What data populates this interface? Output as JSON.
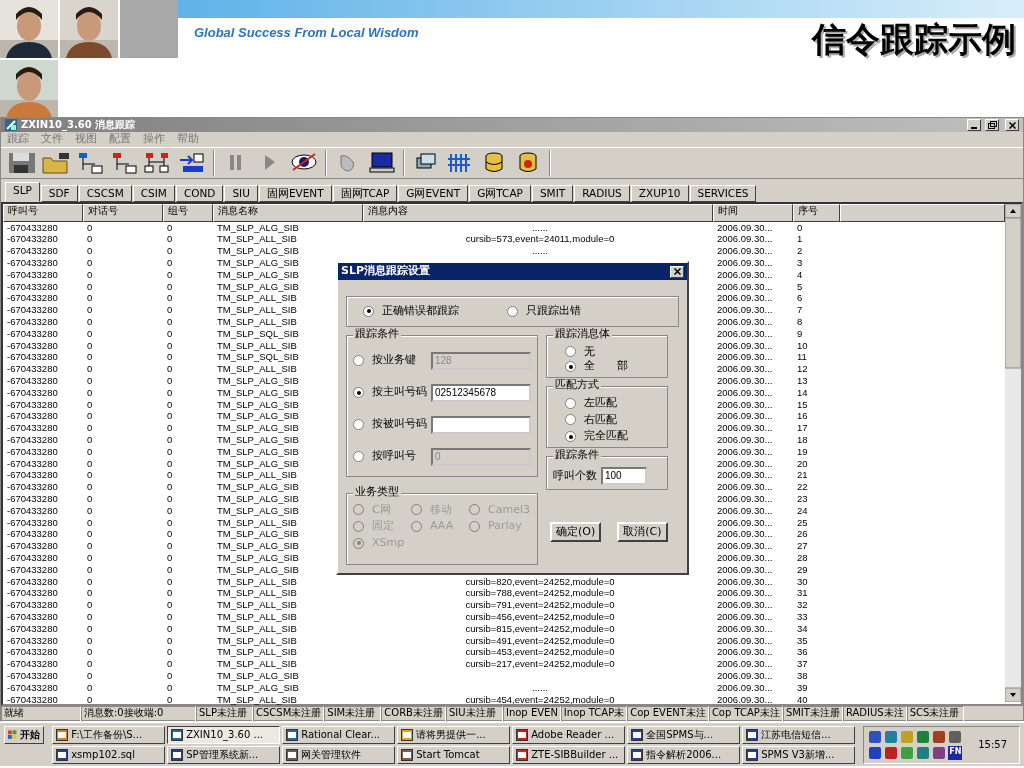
{
  "slide_header": {
    "slogan": "Global Success From Local Wisdom",
    "title": "信令跟踪示例"
  },
  "window": {
    "title": "ZXIN10_3.60 消息跟踪"
  },
  "menu": [
    "跟踪",
    "文件",
    "视图",
    "配置",
    "操作",
    "帮助"
  ],
  "tabs": [
    {
      "label": "SLP",
      "selected": true
    },
    {
      "label": "SDF",
      "selected": false
    },
    {
      "label": "CSCSM",
      "selected": false
    },
    {
      "label": "CSIM",
      "selected": false
    },
    {
      "label": "COND",
      "selected": false
    },
    {
      "label": "SIU",
      "selected": false
    },
    {
      "label": "固网EVENT",
      "selected": false
    },
    {
      "label": "固网TCAP",
      "selected": false
    },
    {
      "label": "G网EVENT",
      "selected": false
    },
    {
      "label": "G网TCAP",
      "selected": false
    },
    {
      "label": "SMIT",
      "selected": false
    },
    {
      "label": "RADIUS",
      "selected": false
    },
    {
      "label": "ZXUP10",
      "selected": false
    },
    {
      "label": "SERVICES",
      "selected": false
    }
  ],
  "table": {
    "columns": [
      "呼叫号",
      "对话号",
      "组号",
      "消息名称",
      "消息内容",
      "时间",
      "序号"
    ],
    "rows": [
      {
        "call": "-670433280",
        "dialog": "0",
        "group": "0",
        "name": "TM_SLP_ALG_SIB",
        "content": "......",
        "time": "2006.09.30...",
        "seq": "0"
      },
      {
        "call": "-670433280",
        "dialog": "0",
        "group": "0",
        "name": "TM_SLP_ALL_SIB",
        "content": "cursib=573,event=24011,module=0",
        "time": "2006.09.30...",
        "seq": "1"
      },
      {
        "call": "-670433280",
        "dialog": "0",
        "group": "0",
        "name": "TM_SLP_ALG_SIB",
        "content": "......",
        "time": "2006.09.30...",
        "seq": "2"
      },
      {
        "call": "-670433280",
        "dialog": "0",
        "group": "0",
        "name": "TM_SLP_ALG_SIB",
        "time": "2006.09.30...",
        "seq": "3"
      },
      {
        "call": "-670433280",
        "dialog": "0",
        "group": "0",
        "name": "TM_SLP_ALG_SIB",
        "time": "2006.09.30...",
        "seq": "4"
      },
      {
        "call": "-670433280",
        "dialog": "0",
        "group": "0",
        "name": "TM_SLP_ALG_SIB",
        "time": "2006.09.30...",
        "seq": "5"
      },
      {
        "call": "-670433280",
        "dialog": "0",
        "group": "0",
        "name": "TM_SLP_ALL_SIB",
        "time": "2006.09.30...",
        "seq": "6"
      },
      {
        "call": "-670433280",
        "dialog": "0",
        "group": "0",
        "name": "TM_SLP_ALL_SIB",
        "time": "2006.09.30...",
        "seq": "7"
      },
      {
        "call": "-670433280",
        "dialog": "0",
        "group": "0",
        "name": "TM_SLP_ALL_SIB",
        "time": "2006.09.30...",
        "seq": "8"
      },
      {
        "call": "-670433280",
        "dialog": "0",
        "group": "0",
        "name": "TM_SLP_SQL_SIB",
        "time": "2006.09.30...",
        "seq": "9"
      },
      {
        "call": "-670433280",
        "dialog": "0",
        "group": "0",
        "name": "TM_SLP_ALL_SIB",
        "time": "2006.09.30...",
        "seq": "10"
      },
      {
        "call": "-670433280",
        "dialog": "0",
        "group": "0",
        "name": "TM_SLP_SQL_SIB",
        "time": "2006.09.30...",
        "seq": "11"
      },
      {
        "call": "-670433280",
        "dialog": "0",
        "group": "0",
        "name": "TM_SLP_ALL_SIB",
        "time": "2006.09.30...",
        "seq": "12"
      },
      {
        "call": "-670433280",
        "dialog": "0",
        "group": "0",
        "name": "TM_SLP_ALG_SIB",
        "time": "2006.09.30...",
        "seq": "13"
      },
      {
        "call": "-670433280",
        "dialog": "0",
        "group": "0",
        "name": "TM_SLP_ALG_SIB",
        "time": "2006.09.30...",
        "seq": "14"
      },
      {
        "call": "-670433280",
        "dialog": "0",
        "group": "0",
        "name": "TM_SLP_ALG_SIB",
        "time": "2006.09.30...",
        "seq": "15"
      },
      {
        "call": "-670433280",
        "dialog": "0",
        "group": "0",
        "name": "TM_SLP_ALG_SIB",
        "time": "2006.09.30...",
        "seq": "16"
      },
      {
        "call": "-670433280",
        "dialog": "0",
        "group": "0",
        "name": "TM_SLP_ALG_SIB",
        "time": "2006.09.30...",
        "seq": "17"
      },
      {
        "call": "-670433280",
        "dialog": "0",
        "group": "0",
        "name": "TM_SLP_ALG_SIB",
        "time": "2006.09.30...",
        "seq": "18"
      },
      {
        "call": "-670433280",
        "dialog": "0",
        "group": "0",
        "name": "TM_SLP_ALG_SIB",
        "time": "2006.09.30...",
        "seq": "19"
      },
      {
        "call": "-670433280",
        "dialog": "0",
        "group": "0",
        "name": "TM_SLP_ALG_SIB",
        "time": "2006.09.30...",
        "seq": "20"
      },
      {
        "call": "-670433280",
        "dialog": "0",
        "group": "0",
        "name": "TM_SLP_ALL_SIB",
        "time": "2006.09.30...",
        "seq": "21"
      },
      {
        "call": "-670433280",
        "dialog": "0",
        "group": "0",
        "name": "TM_SLP_ALG_SIB",
        "time": "2006.09.30...",
        "seq": "22"
      },
      {
        "call": "-670433280",
        "dialog": "0",
        "group": "0",
        "name": "TM_SLP_ALG_SIB",
        "time": "2006.09.30...",
        "seq": "23"
      },
      {
        "call": "-670433280",
        "dialog": "0",
        "group": "0",
        "name": "TM_SLP_ALG_SIB",
        "time": "2006.09.30...",
        "seq": "24"
      },
      {
        "call": "-670433280",
        "dialog": "0",
        "group": "0",
        "name": "TM_SLP_ALL_SIB",
        "time": "2006.09.30...",
        "seq": "25"
      },
      {
        "call": "-670433280",
        "dialog": "0",
        "group": "0",
        "name": "TM_SLP_ALG_SIB",
        "time": "2006.09.30...",
        "seq": "26"
      },
      {
        "call": "-670433280",
        "dialog": "0",
        "group": "0",
        "name": "TM_SLP_ALG_SIB",
        "time": "2006.09.30...",
        "seq": "27"
      },
      {
        "call": "-670433280",
        "dialog": "0",
        "group": "0",
        "name": "TM_SLP_ALG_SIB",
        "time": "2006.09.30...",
        "seq": "28"
      },
      {
        "call": "-670433280",
        "dialog": "0",
        "group": "0",
        "name": "TM_SLP_ALG_SIB",
        "time": "2006.09.30...",
        "seq": "29"
      },
      {
        "call": "-670433280",
        "dialog": "0",
        "group": "0",
        "name": "TM_SLP_ALL_SIB",
        "content": "cursib=820,event=24252,module=0",
        "time": "2006.09.30...",
        "seq": "30"
      },
      {
        "call": "-670433280",
        "dialog": "0",
        "group": "0",
        "name": "TM_SLP_ALL_SIB",
        "content": "cursib=788,event=24252,module=0",
        "time": "2006.09.30...",
        "seq": "31"
      },
      {
        "call": "-670433280",
        "dialog": "0",
        "group": "0",
        "name": "TM_SLP_ALL_SIB",
        "content": "cursib=791,event=24252,module=0",
        "time": "2006.09.30...",
        "seq": "32"
      },
      {
        "call": "-670433280",
        "dialog": "0",
        "group": "0",
        "name": "TM_SLP_ALL_SIB",
        "content": "cursib=456,event=24252,module=0",
        "time": "2006.09.30...",
        "seq": "33"
      },
      {
        "call": "-670433280",
        "dialog": "0",
        "group": "0",
        "name": "TM_SLP_ALL_SIB",
        "content": "cursib=815,event=24252,module=0",
        "time": "2006.09.30...",
        "seq": "34"
      },
      {
        "call": "-670433280",
        "dialog": "0",
        "group": "0",
        "name": "TM_SLP_ALL_SIB",
        "content": "cursib=491,event=24252,module=0",
        "time": "2006.09.30...",
        "seq": "35"
      },
      {
        "call": "-670433280",
        "dialog": "0",
        "group": "0",
        "name": "TM_SLP_ALL_SIB",
        "content": "cursib=453,event=24252,module=0",
        "time": "2006.09.30...",
        "seq": "36"
      },
      {
        "call": "-670433280",
        "dialog": "0",
        "group": "0",
        "name": "TM_SLP_ALL_SIB",
        "content": "cursib=217,event=24252,module=0",
        "time": "2006.09.30...",
        "seq": "37"
      },
      {
        "call": "-670433280",
        "dialog": "0",
        "group": "0",
        "name": "TM_SLP_ALG_SIB",
        "time": "2006.09.30...",
        "seq": "38"
      },
      {
        "call": "-670433280",
        "dialog": "0",
        "group": "0",
        "name": "TM_SLP_ALG_SIB",
        "content": "......",
        "time": "2006.09.30...",
        "seq": "39"
      },
      {
        "call": "-670433280",
        "dialog": "0",
        "group": "0",
        "name": "TM_SLP_ALL_SIB",
        "content": "cursib=454,event=24252,module=0",
        "time": "2006.09.30...",
        "seq": "40"
      }
    ]
  },
  "dialog": {
    "title": "SLP消息跟踪设置",
    "trace_mode": [
      {
        "label": "正确错误都跟踪",
        "selected": true
      },
      {
        "label": "只跟踪出错",
        "selected": false
      }
    ],
    "trace_conditions": {
      "title": "跟踪条件",
      "options": [
        {
          "label": "按业务键",
          "selected": false,
          "value": "128",
          "disabled": true
        },
        {
          "label": "按主叫号码",
          "selected": true,
          "value": "02512345678",
          "disabled": false
        },
        {
          "label": "按被叫号码",
          "selected": false,
          "disabled": false
        },
        {
          "label": "按呼叫号",
          "selected": false,
          "value": "0",
          "disabled": true
        }
      ]
    },
    "message_body": {
      "title": "跟踪消息体",
      "options": [
        {
          "label": "无",
          "selected": false
        },
        {
          "label": "全　　部",
          "selected": true
        }
      ]
    },
    "match_mode": {
      "title": "匹配方式",
      "options": [
        {
          "label": "左匹配",
          "selected": false
        },
        {
          "label": "右匹配",
          "selected": false
        },
        {
          "label": "完全匹配",
          "selected": true
        }
      ]
    },
    "call_limit": {
      "title": "跟踪条件",
      "label": "呼叫个数",
      "value": "100"
    },
    "service_type": {
      "title": "业务类型",
      "disabled": true,
      "options": [
        {
          "label": "C网",
          "selected": false
        },
        {
          "label": "移动",
          "selected": false
        },
        {
          "label": "Camel3",
          "selected": false
        },
        {
          "label": "固定",
          "selected": false
        },
        {
          "label": "AAA",
          "selected": false
        },
        {
          "label": "Parlay",
          "selected": false
        },
        {
          "label": "XSmp",
          "selected": true
        }
      ]
    },
    "buttons": [
      "确定(O)",
      "取消(C)"
    ]
  },
  "status_bar": [
    "就绪",
    "消息数:0接收端:0",
    "SLP未注册",
    "CSCSM未注册",
    "SIM未注册",
    "CORB未注册",
    "SIU未注册",
    "Inop EVEN",
    "Inop TCAP未",
    "Cop EVENT未注",
    "Cop TCAP未注",
    "SMIT未注册",
    "RADIUS未注",
    "SCS未注册"
  ],
  "taskbar": {
    "start": "开始",
    "buttons": [
      {
        "label": "F:\\工作备份\\S...",
        "selected": false
      },
      {
        "label": "ZXIN10_3.60 ...",
        "selected": true
      },
      {
        "label": "Rational Clear...",
        "selected": false
      },
      {
        "label": "请将男提供一...",
        "selected": false
      },
      {
        "label": "Adobe Reader ...",
        "selected": false
      },
      {
        "label": "全国SPMS与...",
        "selected": false
      },
      {
        "label": "江苏电信短信...",
        "selected": false
      },
      {
        "label": "xsmp102.sql",
        "selected": false
      },
      {
        "label": "SP管理系统新...",
        "selected": false
      },
      {
        "label": "网关管理软件",
        "selected": false
      },
      {
        "label": "Start Tomcat",
        "selected": false
      },
      {
        "label": "ZTE-SIBBuilder ...",
        "selected": false
      },
      {
        "label": "指令解析2006...",
        "selected": false
      },
      {
        "label": "SPMS V3新增...",
        "selected": false
      }
    ],
    "tray_label": "FN",
    "clock": "15:57"
  }
}
